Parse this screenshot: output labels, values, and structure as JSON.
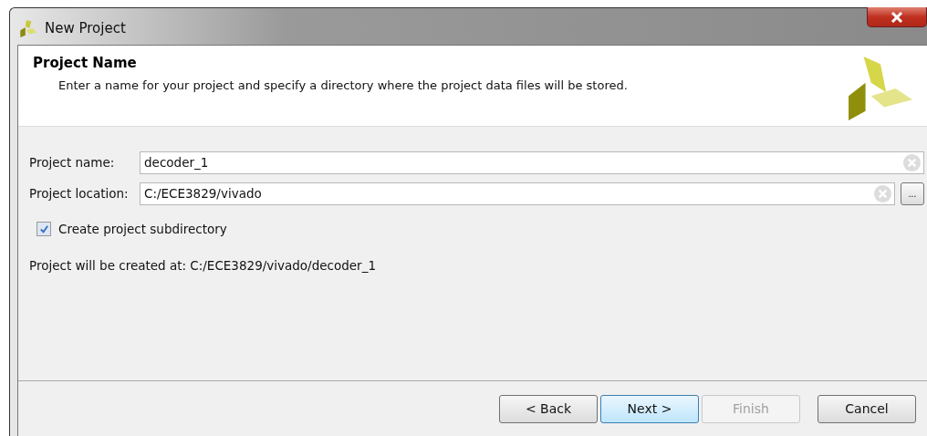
{
  "window": {
    "title": "New Project"
  },
  "header": {
    "title": "Project Name",
    "description": "Enter a name for your project and specify a directory where the project data files will be stored."
  },
  "fields": [
    {
      "label": "Project name:",
      "value": "decoder_1",
      "browse": false
    },
    {
      "label": "Project location:",
      "value": "C:/ECE3829/vivado",
      "browse": true,
      "browse_label": "..."
    }
  ],
  "checkbox": {
    "label": "Create project subdirectory",
    "checked": true
  },
  "summary": "Project will be created at: C:/ECE3829/vivado/decoder_1",
  "buttons": [
    {
      "label": "< Back",
      "default": false,
      "disabled": false
    },
    {
      "label": "Next >",
      "default": true,
      "disabled": false
    },
    {
      "label": "Finish",
      "default": false,
      "disabled": true
    },
    {
      "label": "Cancel",
      "default": false,
      "disabled": false
    }
  ]
}
